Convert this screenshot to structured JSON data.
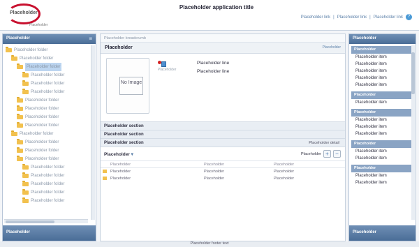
{
  "header": {
    "logo_text": "Placeholder",
    "logo_sub": "Placeholder",
    "title": "Placeholder application title",
    "user_links": [
      "Placeholder link",
      "Placeholder link",
      "Placeholder link"
    ]
  },
  "left_panel": {
    "header": "Placeholder",
    "tree": [
      {
        "label": "Placeholder folder",
        "indent": 0,
        "selected": false
      },
      {
        "label": "Placeholder folder",
        "indent": 1,
        "selected": false
      },
      {
        "label": "Placeholder folder",
        "indent": 2,
        "selected": true
      },
      {
        "label": "Placeholder folder",
        "indent": 3,
        "selected": false
      },
      {
        "label": "Placeholder folder",
        "indent": 3,
        "selected": false
      },
      {
        "label": "Placeholder folder",
        "indent": 3,
        "selected": false
      },
      {
        "label": "Placeholder folder",
        "indent": 2,
        "selected": false
      },
      {
        "label": "Placeholder folder",
        "indent": 2,
        "selected": false
      },
      {
        "label": "Placeholder folder",
        "indent": 2,
        "selected": false
      },
      {
        "label": "Placeholder folder",
        "indent": 2,
        "selected": false
      },
      {
        "label": "Placeholder folder",
        "indent": 1,
        "selected": false
      },
      {
        "label": "Placeholder folder",
        "indent": 2,
        "selected": false
      },
      {
        "label": "Placeholder folder",
        "indent": 2,
        "selected": false
      },
      {
        "label": "Placeholder folder",
        "indent": 2,
        "selected": false
      },
      {
        "label": "Placeholder folder",
        "indent": 3,
        "selected": false
      },
      {
        "label": "Placeholder folder",
        "indent": 3,
        "selected": false
      },
      {
        "label": "Placeholder folder",
        "indent": 3,
        "selected": false
      },
      {
        "label": "Placeholder folder",
        "indent": 3,
        "selected": false
      },
      {
        "label": "Placeholder folder",
        "indent": 3,
        "selected": false
      }
    ],
    "footer": "Placeholder"
  },
  "main": {
    "breadcrumb": "Placeholder breadcrumb",
    "doc_title": "Placeholder",
    "doc_link": "Placeholder",
    "no_image": "No Image",
    "meta_sub": "Placeholder",
    "doc_lines": [
      "Placeholder line",
      "Placeholder line"
    ],
    "sections": [
      {
        "label": "Placeholder section",
        "extra": ""
      },
      {
        "label": "Placeholder section",
        "extra": ""
      },
      {
        "label": "Placeholder section",
        "extra": "Placeholder detail"
      }
    ],
    "files_label": "Placeholder",
    "files_right_label": "Placeholder",
    "grid_headers": [
      "Placeholder",
      "Placeholder",
      "Placeholder"
    ],
    "grid_rows": [
      [
        "Placeholder",
        "Placeholder",
        "Placeholder"
      ],
      [
        "Placeholder",
        "Placeholder",
        "Placeholder"
      ]
    ]
  },
  "right_panel": {
    "header": "Placeholder",
    "groups": [
      {
        "title": "Placeholder",
        "items": [
          "Placeholder item",
          "Placeholder item",
          "Placeholder item",
          "Placeholder item",
          "Placeholder item"
        ]
      },
      {
        "title": "Placeholder",
        "items": [
          "Placeholder item"
        ]
      },
      {
        "title": "Placeholder",
        "items": [
          "Placeholder item",
          "Placeholder item",
          "Placeholder item"
        ]
      },
      {
        "title": "Placeholder",
        "items": [
          "Placeholder item",
          "Placeholder item"
        ]
      },
      {
        "title": "Placeholder",
        "items": [
          "Placeholder item",
          "Placeholder item"
        ]
      }
    ],
    "footer": "Placeholder"
  },
  "footer": "Placeholder footer text",
  "colors": {
    "panel_header": "#4a6d97",
    "folder": "#f2c14e",
    "accent": "#c8102e"
  },
  "icons": {
    "help": "help-icon",
    "collapse": "collapse-icon",
    "zoom_in": "zoom-in-icon",
    "zoom_out": "zoom-out-icon"
  }
}
